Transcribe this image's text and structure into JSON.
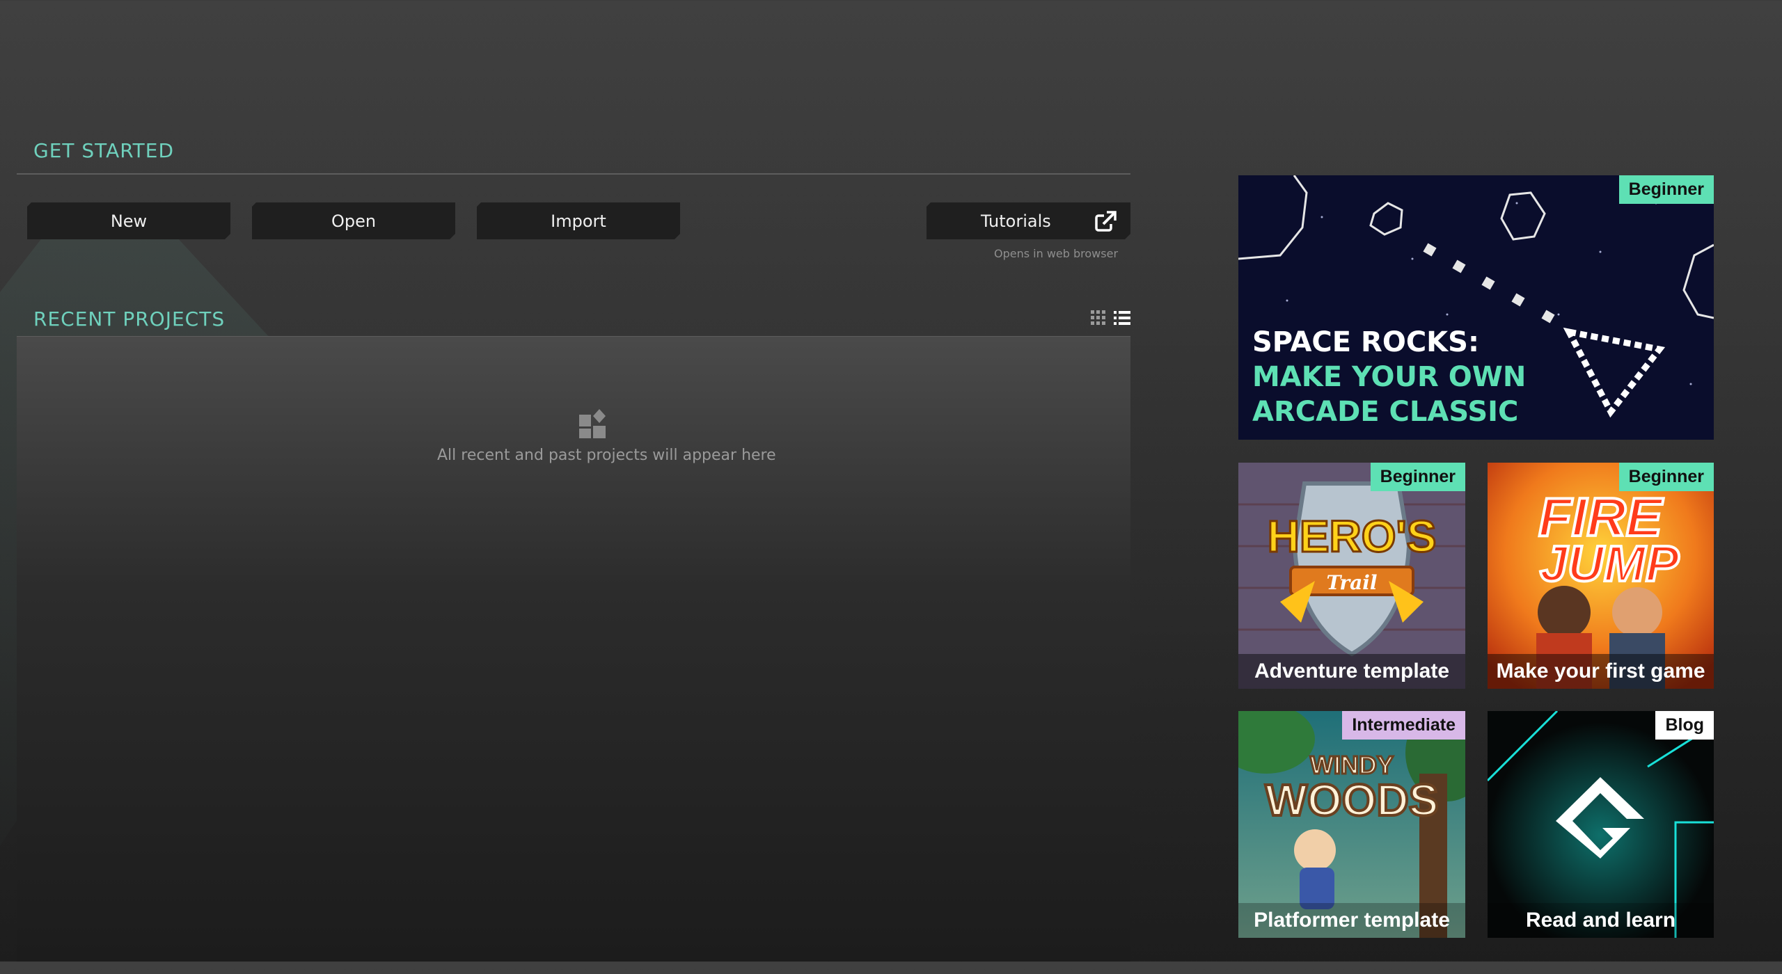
{
  "get_started": {
    "title": "GET STARTED",
    "buttons": {
      "new": "New",
      "open": "Open",
      "import": "Import",
      "tutorials": "Tutorials"
    },
    "tutorials_hint": "Opens in web browser"
  },
  "recent_projects": {
    "title": "RECENT PROJECTS",
    "empty_text": "All recent and past projects will appear here"
  },
  "tiles": {
    "space_rocks": {
      "badge": "Beginner",
      "line1": "SPACE ROCKS:",
      "line2": "MAKE YOUR OWN",
      "line3": "ARCADE CLASSIC"
    },
    "heros_trail": {
      "badge": "Beginner",
      "caption": "Adventure template",
      "art_title": "HERO'S",
      "art_subtitle": "Trail"
    },
    "fire_jump": {
      "badge": "Beginner",
      "caption": "Make your first game",
      "art_line1": "FIRE",
      "art_line2": "JUMP"
    },
    "windy_woods": {
      "badge": "Intermediate",
      "caption": "Platformer template",
      "art_line1": "WINDY",
      "art_line2": "WOODS"
    },
    "blog": {
      "badge": "Blog",
      "caption": "Read and learn"
    }
  },
  "colors": {
    "accent": "#6fd1bd",
    "badge_beginner": "#5ee0b4",
    "badge_intermediate": "#d8b8e8",
    "badge_blog": "#ffffff"
  }
}
